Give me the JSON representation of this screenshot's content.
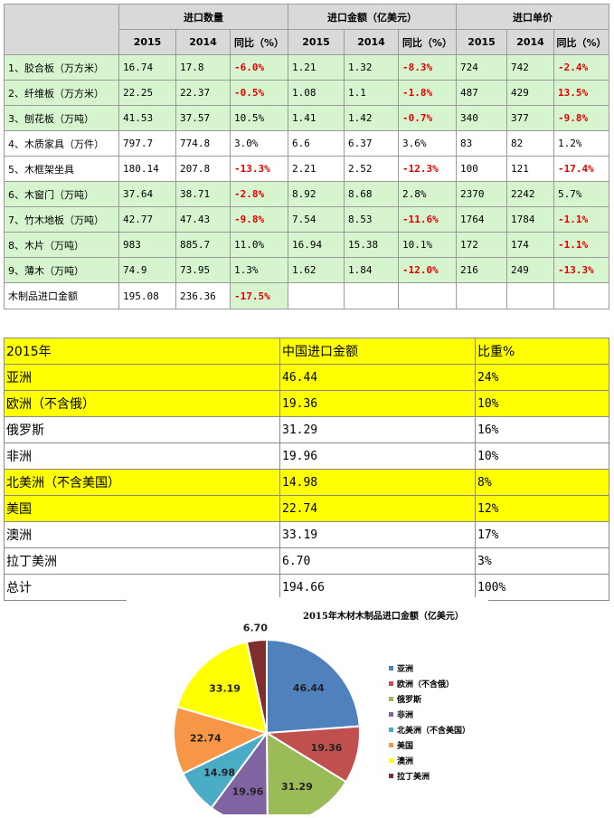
{
  "table1": {
    "header": {
      "group1": "进口数量",
      "group2": "进口金额（亿美元）",
      "group3": "进口单价",
      "sub": [
        "2015",
        "2014",
        "同比（%）",
        "2015",
        "2014",
        "同比（%）",
        "2015",
        "2014",
        "同比（%）"
      ]
    },
    "rows": [
      {
        "name": "1、胶合板（万方米）",
        "cells": [
          "16.74",
          "17.8",
          "-6.0%",
          "1.21",
          "1.32",
          "-8.3%",
          "724",
          "742",
          "-2.4%"
        ]
      },
      {
        "name": "2、纤维板（万方米）",
        "cells": [
          "22.25",
          "22.37",
          "-0.5%",
          "1.08",
          "1.1",
          "-1.8%",
          "487",
          "429",
          "13.5%"
        ]
      },
      {
        "name": "3、刨花板（万吨）",
        "cells": [
          "41.53",
          "37.57",
          "10.5%",
          "1.41",
          "1.42",
          "-0.7%",
          "340",
          "377",
          "-9.8%"
        ]
      },
      {
        "name": "4、木质家具（万件）",
        "cells": [
          "797.7",
          "774.8",
          "3.0%",
          "6.6",
          "6.37",
          "3.6%",
          "83",
          "82",
          "1.2%"
        ]
      },
      {
        "name": "5、木框架坐具",
        "cells": [
          "180.14",
          "207.8",
          "-13.3%",
          "2.21",
          "2.52",
          "-12.3%",
          "100",
          "121",
          "-17.4%"
        ]
      },
      {
        "name": "6、木窗门（万吨）",
        "cells": [
          "37.64",
          "38.71",
          "-2.8%",
          "8.92",
          "8.68",
          "2.8%",
          "2370",
          "2242",
          "5.7%"
        ]
      },
      {
        "name": "7、竹木地板（万吨）",
        "cells": [
          "42.77",
          "47.43",
          "-9.8%",
          "7.54",
          "8.53",
          "-11.6%",
          "1764",
          "1784",
          "-1.1%"
        ]
      },
      {
        "name": "8、木片（万吨）",
        "cells": [
          "983",
          "885.7",
          "11.0%",
          "16.94",
          "15.38",
          "10.1%",
          "172",
          "174",
          "-1.1%"
        ]
      },
      {
        "name": "9、薄木（万吨）",
        "cells": [
          "74.9",
          "73.95",
          "1.3%",
          "1.62",
          "1.84",
          "-12.0%",
          "216",
          "249",
          "-13.3%"
        ]
      },
      {
        "name": "木制品进口金额",
        "cells": [
          "195.08",
          "236.36",
          "-17.5%",
          "",
          "",
          "",
          "",
          "",
          ""
        ]
      }
    ]
  },
  "table2": {
    "header": [
      "2015年",
      "中国进口金额",
      "比重%"
    ],
    "rows": [
      [
        "亚洲",
        "46.44",
        "24%"
      ],
      [
        "欧洲（不含俄）",
        "19.36",
        "10%"
      ],
      [
        "俄罗斯",
        "31.29",
        "16%"
      ],
      [
        "非洲",
        "19.96",
        "10%"
      ],
      [
        "北美洲（不含美国）",
        "14.98",
        "8%"
      ],
      [
        "美国",
        "22.74",
        "12%"
      ],
      [
        "澳洲",
        "33.19",
        "17%"
      ],
      [
        "拉丁美洲",
        "6.70",
        "3%"
      ],
      [
        "总计",
        "194.66",
        "100%"
      ]
    ]
  },
  "chart_data": {
    "type": "pie",
    "title": "2015年木材木制品进口金额（亿美元）",
    "categories": [
      "亚洲",
      "欧洲（不含俄）",
      "俄罗斯",
      "非洲",
      "北美洲（不含美国）",
      "美国",
      "澳洲",
      "拉丁美洲"
    ],
    "values": [
      46.44,
      19.36,
      31.29,
      19.96,
      14.98,
      22.74,
      33.19,
      6.7
    ],
    "labels": [
      "46.44",
      "19.36",
      "31.29",
      "19.96",
      "14.98",
      "22.74",
      "33.19",
      "6.70"
    ],
    "colors": [
      "#4f81bd",
      "#c0504d",
      "#9bbb59",
      "#8064a2",
      "#4bacc6",
      "#f79646",
      "#ffff00",
      "#7f2d2d"
    ],
    "legend_position": "right"
  },
  "colors": {
    "green_row": "#d6f5cf",
    "header_gray": "#d9d9d9",
    "negative_red": "#e00000",
    "yellow_row": "#ffff00"
  }
}
